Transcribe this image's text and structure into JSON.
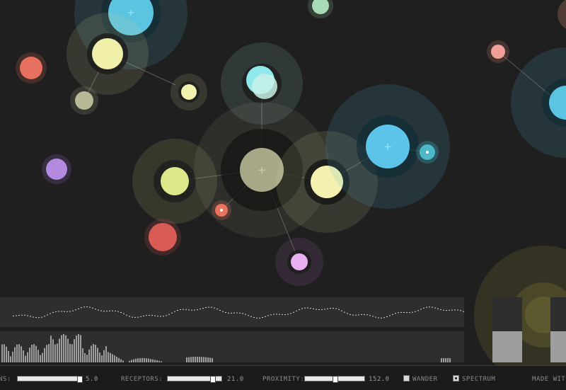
{
  "controls": {
    "first_label": "NS:",
    "first_value": "5.0",
    "first_level": 1.0,
    "receptors_label": "RECEPTORS:",
    "receptors_value": "21.0",
    "receptors_level": 0.85,
    "proximity_label": "PROXIMITY:",
    "proximity_value": "152.0",
    "proximity_level": 0.5,
    "wander_label": "WANDER",
    "wander_checked": false,
    "spectrum_label": "SPECTRUM",
    "spectrum_checked": true,
    "credit_label": "MADE WIT"
  },
  "meters": [
    {
      "level": 0.48
    },
    {
      "level": 0.48
    }
  ],
  "colors": {
    "background": "#1f1f1f",
    "panel": "#2e2e2e",
    "bars": "#9e9e9e"
  },
  "icons": {
    "plus": "plus-icon",
    "check": "check-icon"
  }
}
